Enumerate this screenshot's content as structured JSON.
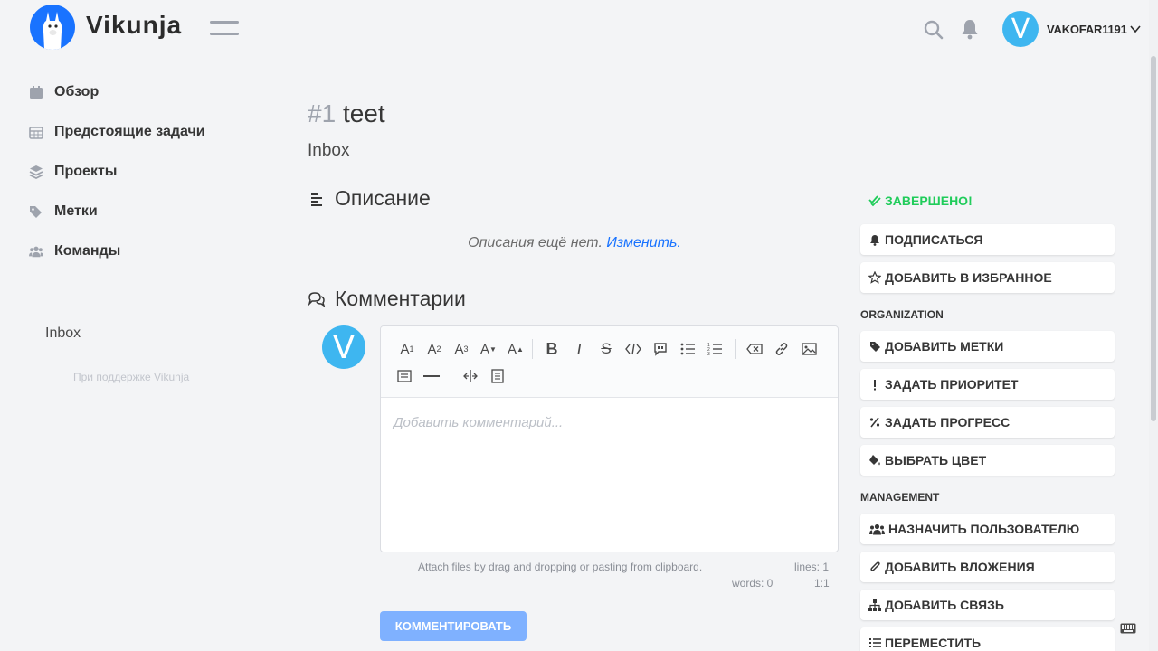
{
  "header": {
    "app_name": "Vikunja",
    "username": "VAKOFAR1191",
    "avatar_letter": "V"
  },
  "sidebar": {
    "items": [
      {
        "label": "Обзор",
        "icon": "calendar-icon"
      },
      {
        "label": "Предстоящие задачи",
        "icon": "calendar-grid-icon"
      },
      {
        "label": "Проекты",
        "icon": "layers-icon"
      },
      {
        "label": "Метки",
        "icon": "tags-icon"
      },
      {
        "label": "Команды",
        "icon": "users-icon"
      }
    ],
    "project": "Inbox",
    "powered_by": "При поддержке Vikunja"
  },
  "task": {
    "number": "#1",
    "title": "teet",
    "project": "Inbox"
  },
  "description": {
    "heading": "Описание",
    "empty_text": "Описания ещё нет.",
    "edit_link": "Изменить."
  },
  "comments": {
    "heading": "Комментарии",
    "avatar_letter": "V",
    "placeholder": "Добавить комментарий...",
    "attach_hint": "Attach files by drag and dropping or pasting from clipboard.",
    "lines": "lines: 1",
    "words": "words: 0",
    "cursor": "1:1",
    "submit_label": "КОММЕНТИРОВАТЬ"
  },
  "actions": {
    "done_label": "ЗАВЕРШЕНО!",
    "subscribe": "ПОДПИСАТЬСЯ",
    "favorite": "ДОБАВИТЬ В ИЗБРАННОЕ",
    "organization_heading": "ORGANIZATION",
    "labels": "ДОБАВИТЬ МЕТКИ",
    "priority": "ЗАДАТЬ ПРИОРИТЕТ",
    "progress": "ЗАДАТЬ ПРОГРЕСС",
    "color": "ВЫБРАТЬ ЦВЕТ",
    "management_heading": "MANAGEMENT",
    "assign": "НАЗНАЧИТЬ ПОЛЬЗОВАТЕЛЮ",
    "attachments": "ДОБАВИТЬ ВЛОЖЕНИЯ",
    "relation": "ДОБАВИТЬ СВЯЗЬ",
    "move": "ПЕРЕМЕСТИТЬ"
  },
  "colors": {
    "accent": "#1973ff",
    "done": "#1fcc5a",
    "avatar": "#3eb6f0"
  }
}
